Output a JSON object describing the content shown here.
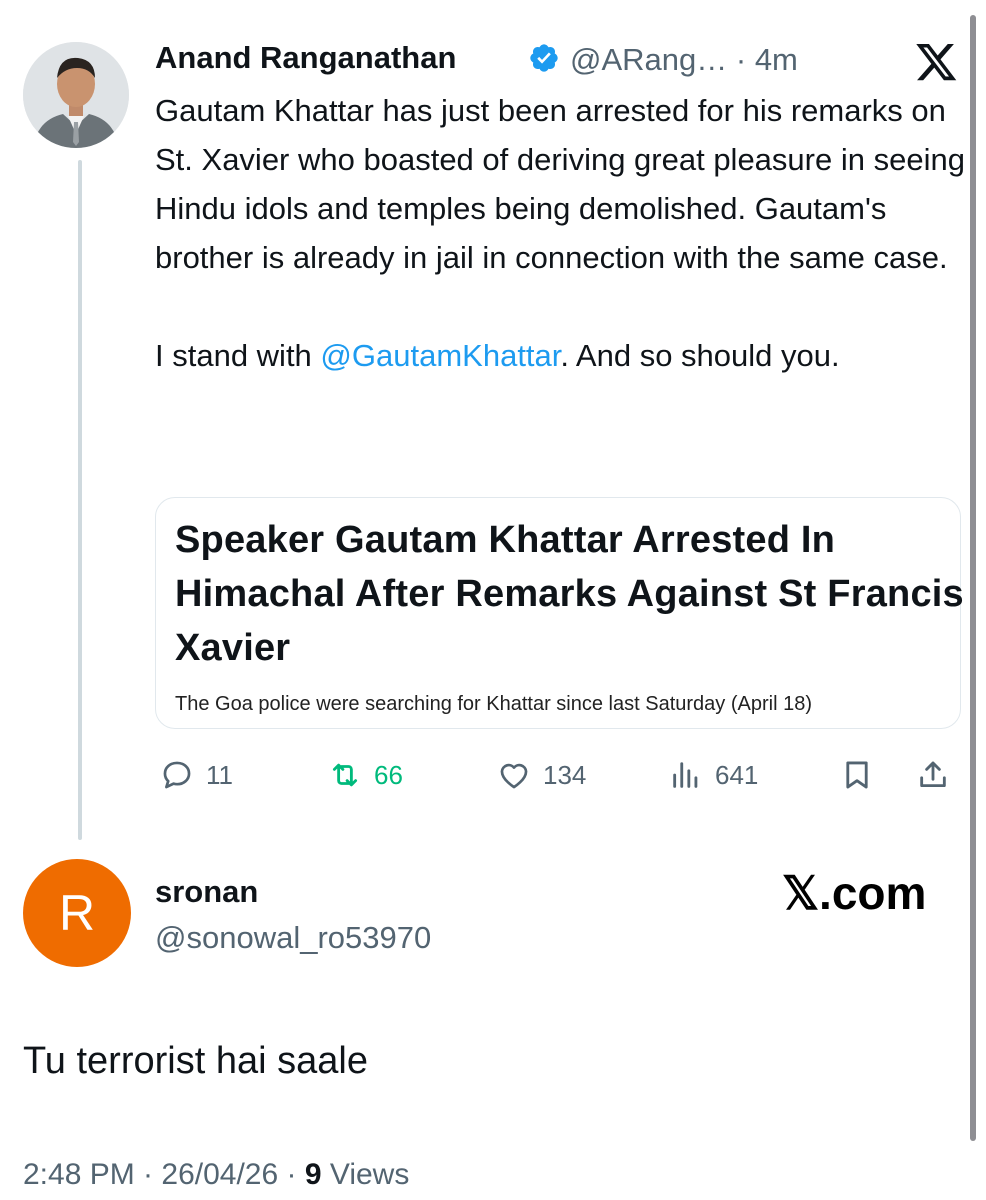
{
  "tweet": {
    "author_name": "Anand Ranganathan",
    "handle": "@ARang…",
    "time": " · 4m",
    "text_part1": "Gautam Khattar has just been arrested for his remarks on St. Xavier who boasted of deriving great pleasure in seeing Hindu idols and temples being demolished. Gautam's brother is already in jail in connection with the same case.\n\nI stand with ",
    "mention": "@GautamKhattar",
    "text_part2": ". And so should you.",
    "card": {
      "headline": "Speaker Gautam Khattar Arrested In Himachal After Remarks Against St Francis Xavier",
      "subtitle": "The Goa police were searching for Khattar since last Saturday (April 18)"
    },
    "actions": {
      "replies": "11",
      "reposts": "66",
      "likes": "134",
      "views": "641"
    },
    "colors": {
      "mention": "#1d9bf0",
      "repost": "#00ba7c",
      "verified": "#1d9bf0"
    }
  },
  "reply": {
    "avatar_letter": "R",
    "avatar_color": "#ef6c00",
    "name": "sronan",
    "handle": "@sonowal_ro53970",
    "watermark": "𝕏.com",
    "text": "Tu terrorist hai saale",
    "timestamp": "2:48 PM · 26/04/26 · ",
    "views_count": "9",
    "views_label": " Views"
  }
}
